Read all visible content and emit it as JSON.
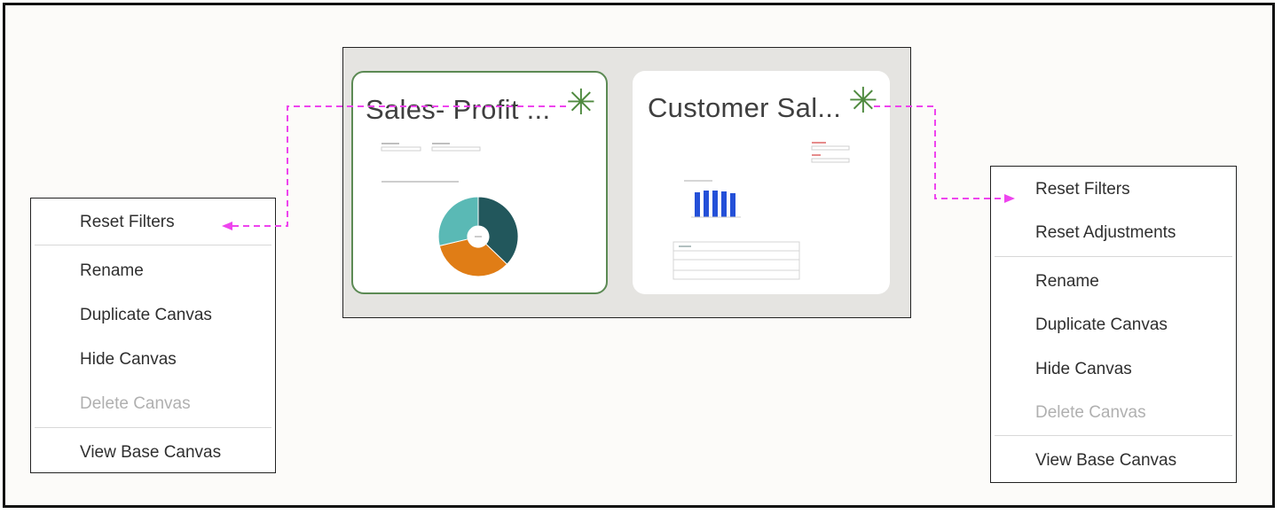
{
  "canvases": [
    {
      "title": "Sales- Profit ...",
      "modified_icon": "asterisk-icon",
      "selected": true,
      "thumbnail": "donut-chart"
    },
    {
      "title": "Customer Sal...",
      "modified_icon": "asterisk-icon",
      "selected": false,
      "thumbnail": "bar-chart-and-table"
    }
  ],
  "menu_left": {
    "items": [
      {
        "label": "Reset Filters",
        "enabled": true
      },
      {
        "label": "Rename",
        "enabled": true
      },
      {
        "label": "Duplicate Canvas",
        "enabled": true
      },
      {
        "label": "Hide Canvas",
        "enabled": true
      },
      {
        "label": "Delete Canvas",
        "enabled": false
      },
      {
        "label": "View Base Canvas",
        "enabled": true
      }
    ]
  },
  "menu_right": {
    "items": [
      {
        "label": "Reset Filters",
        "enabled": true
      },
      {
        "label": "Reset Adjustments",
        "enabled": true
      },
      {
        "label": "Rename",
        "enabled": true
      },
      {
        "label": "Duplicate Canvas",
        "enabled": true
      },
      {
        "label": "Hide Canvas",
        "enabled": true
      },
      {
        "label": "Delete Canvas",
        "enabled": false
      },
      {
        "label": "View Base Canvas",
        "enabled": true
      }
    ]
  },
  "colors": {
    "connector": "#ee44ee",
    "selected_border": "#5c8a54",
    "asterisk": "#4f8a3f",
    "donut_teal_dark": "#22575c",
    "donut_orange": "#e07d16",
    "donut_teal_light": "#5ab9b5",
    "bar_blue": "#2450d8"
  }
}
